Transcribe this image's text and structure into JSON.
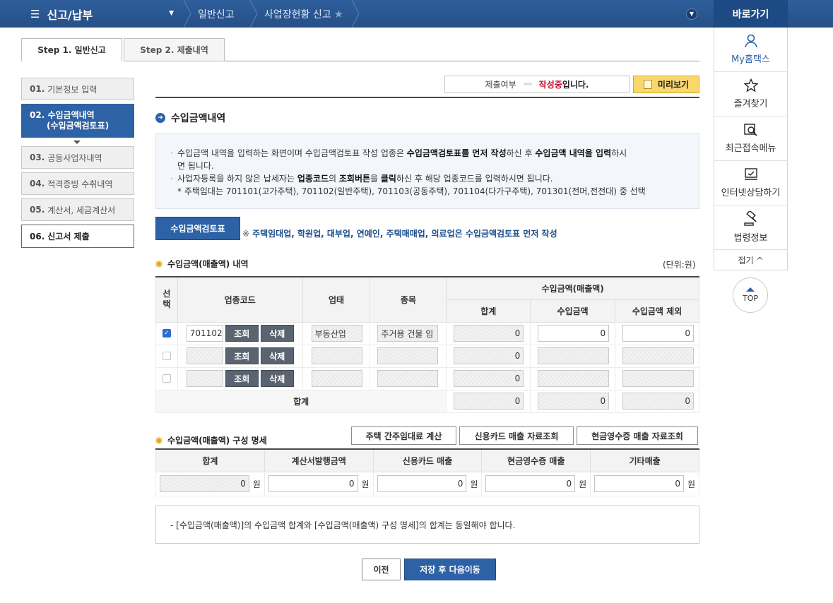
{
  "topbar": {
    "menu_label": "신고/납부",
    "crumbs": [
      "일반신고",
      "사업장현황 신고"
    ],
    "goto_label": "바로가기"
  },
  "quick_menu": {
    "items": [
      "My홈택스",
      "즐겨찾기",
      "최근접속메뉴",
      "인터넷상담하기",
      "법령정보"
    ],
    "fold_label": "접기 ^",
    "top_label": "TOP"
  },
  "tabs": [
    "Step 1. 일반신고",
    "Step 2. 제출내역"
  ],
  "left_nav": {
    "items": [
      {
        "num": "01.",
        "label": "기본정보 입력"
      },
      {
        "num": "02.",
        "label": "수입금액내역",
        "label2": "(수입금액검토표)"
      },
      {
        "num": "03.",
        "label": "공동사업자내역"
      },
      {
        "num": "04.",
        "label": "적격증빙 수취내역"
      },
      {
        "num": "05.",
        "label": "계산서, 세금계산서"
      },
      {
        "num": "06.",
        "label": "신고서 제출"
      }
    ]
  },
  "status": {
    "label": "제출여부",
    "arrows": "››››",
    "state": "작성중",
    "state_suffix": "입니다.",
    "preview_label": "미리보기"
  },
  "section": {
    "title": "수입금액내역",
    "notice_1a": "수입금액 내역을 입력하는 화면이며 수입금액검토표 작성 업종은 ",
    "notice_1b": "수입금액검토표를 먼저 작성",
    "notice_1c": "하신 후 ",
    "notice_1d": "수입금액 내역을 입력",
    "notice_1e": "하시",
    "notice_1f": "면 됩니다.",
    "notice_2a": "사업자등록을 하지 않은 납세자는 ",
    "notice_2b": "업종코드",
    "notice_2c": "의 ",
    "notice_2d": "조회버튼",
    "notice_2e": "을 ",
    "notice_2f": "클릭",
    "notice_2g": "하신 후 해당 업종코드를 입력하시면 됩니다.",
    "notice_3": "* 주택임대는 701101(고가주택), 701102(일반주택), 701103(공동주택), 701104(다가구주택), 701301(전머,전전대) 중 선택",
    "review_button": "수입금액검토표",
    "review_note_mark": "※",
    "review_note": "주택임대업, 학원업, 대부업, 연예인, 주택매매업, 의료업은 수입금액검토표 먼저 작성"
  },
  "revenue_table": {
    "title": "수입금액(매출액) 내역",
    "unit": "(단위:원)",
    "headers": {
      "select": "선택",
      "code": "업종코드",
      "business": "업태",
      "item": "종목",
      "revenue_group": "수입금액(매출액)",
      "sum": "합계",
      "revenue": "수입금액",
      "excluded": "수입금액 제외"
    },
    "lookup_label": "조회",
    "delete_label": "삭제",
    "rows": [
      {
        "code": "701102",
        "business": "부동산업",
        "item": "주거용 건물 임",
        "sum": "0",
        "revenue": "0",
        "excluded": "0"
      },
      {
        "code": "",
        "business": "",
        "item": "",
        "sum": "0",
        "revenue": "",
        "excluded": ""
      },
      {
        "code": "",
        "business": "",
        "item": "",
        "sum": "0",
        "revenue": "",
        "excluded": ""
      }
    ],
    "total_label": "합계",
    "total": {
      "sum": "0",
      "revenue": "0",
      "excluded": "0"
    }
  },
  "composition": {
    "title": "수입금액(매출액) 구성 명세",
    "buttons": [
      "주택 간주임대료 계산",
      "신용카드 매출 자료조회",
      "현금영수증 매출 자료조회"
    ],
    "headers": [
      "합계",
      "계산서발행금액",
      "신용카드 매출",
      "현금영수증 매출",
      "기타매출"
    ],
    "values": [
      "0",
      "0",
      "0",
      "0",
      "0"
    ],
    "currency": "원"
  },
  "info_text": "- [수입금액(매출액)]의 수입금액 합계와 [수입금액(매출액) 구성 명세]의 합계는 동일해야 합니다.",
  "footer": {
    "prev_label": "이전",
    "next_label": "저장 후 다음이동"
  },
  "colors": {
    "primary_blue": "#2e62a6",
    "topbar": "#2e5f9c",
    "status_red": "#c8102e",
    "preview_yellow": "#f9d86b"
  }
}
